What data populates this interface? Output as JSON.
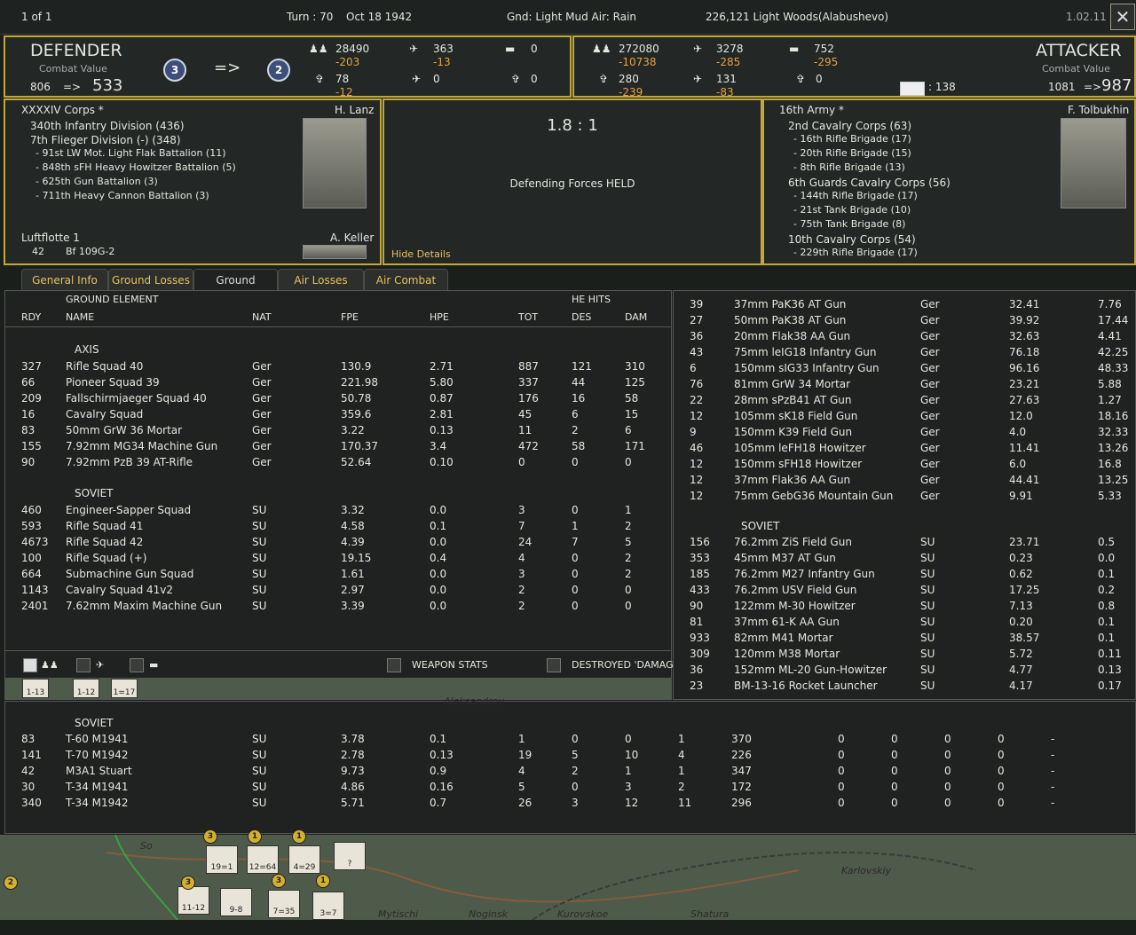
{
  "topbar": {
    "page": "1 of 1",
    "turn": "Turn : 70",
    "date": "Oct 18 1942",
    "weather": "Gnd: Light Mud  Air: Rain",
    "location": "226,121  Light Woods(Alabushevo)",
    "version": "1.02.11",
    "close": "✕"
  },
  "defender": {
    "title": "DEFENDER",
    "cv_label": "Combat Value",
    "cv_from": "806",
    "arrow": "=>",
    "cv_to": "533",
    "badge_from": "3",
    "badge_to": "2",
    "arrow_big": "=>",
    "men": "28490",
    "men_loss": "-203",
    "air": "363",
    "air_loss": "-13",
    "tanks": "0",
    "guns": "78",
    "guns_loss": "-12",
    "air2": "0",
    "guns2": "0"
  },
  "attacker": {
    "title": "ATTACKER",
    "cv_label": "Combat Value",
    "cv_from": "1081",
    "arrow": "=>",
    "cv_to": "987",
    "men": "272080",
    "men_loss": "-10738",
    "air": "3278",
    "air_loss": "-285",
    "tanks": "752",
    "tanks_loss": "-295",
    "guns": "280",
    "guns_loss": "-239",
    "air2": "131",
    "air2_loss": "-83",
    "guns2": "0",
    "trucks": ": 138"
  },
  "def_units": {
    "hq": "XXXXIV Corps *",
    "commander": "H. Lanz",
    "list": [
      {
        "t": "340th Infantry Division (436)",
        "lvl": 1
      },
      {
        "t": "7th Flieger Division (-) (348)",
        "lvl": 1
      },
      {
        "t": "- 91st LW Mot. Light Flak Battalion (11)",
        "lvl": 2
      },
      {
        "t": "- 848th sFH Heavy Howitzer Battalion (5)",
        "lvl": 2
      },
      {
        "t": "- 625th Gun Battalion (3)",
        "lvl": 2
      },
      {
        "t": "- 711th Heavy Cannon Battalion (3)",
        "lvl": 2
      }
    ],
    "air_hq": "Luftflotte 1",
    "air_commander": "A. Keller",
    "air_count": "42",
    "air_type": "Bf 109G-2"
  },
  "result": {
    "ratio": "1.8 : 1",
    "outcome": "Defending Forces HELD",
    "hide": "Hide Details"
  },
  "att_units": {
    "hq": "16th Army *",
    "commander": "F. Tolbukhin",
    "list": [
      {
        "t": "2nd Cavalry Corps (63)",
        "lvl": 1
      },
      {
        "t": "- 16th Rifle Brigade (17)",
        "lvl": 2
      },
      {
        "t": "- 20th Rifle Brigade (15)",
        "lvl": 2
      },
      {
        "t": "- 8th Rifle Brigade (13)",
        "lvl": 2
      },
      {
        "t": "6th Guards Cavalry Corps (56)",
        "lvl": 1
      },
      {
        "t": "- 144th Rifle Brigade (17)",
        "lvl": 2
      },
      {
        "t": "- 21st Tank Brigade (10)",
        "lvl": 2
      },
      {
        "t": "- 75th Tank Brigade (8)",
        "lvl": 2
      },
      {
        "t": "10th Cavalry Corps (54)",
        "lvl": 1
      },
      {
        "t": "- 229th Rifle Brigade (17)",
        "lvl": 2
      }
    ]
  },
  "tabs": [
    "General Info",
    "Ground Losses",
    "Ground Combat",
    "Air Losses",
    "Air Combat"
  ],
  "table": {
    "group_header": "GROUND ELEMENT",
    "he_hits": "HE HITS",
    "cols": [
      "RDY",
      "NAME",
      "NAT",
      "FPE",
      "HPE",
      "TOT",
      "DES",
      "DAM"
    ],
    "axis_label": "AXIS",
    "soviet_label": "SOVIET",
    "axis": [
      [
        "327",
        "Rifle Squad 40",
        "Ger",
        "130.9",
        "2.71",
        "887",
        "121",
        "310"
      ],
      [
        "66",
        "Pioneer Squad 39",
        "Ger",
        "221.98",
        "5.80",
        "337",
        "44",
        "125"
      ],
      [
        "209",
        "Fallschirmjaeger Squad 40",
        "Ger",
        "50.78",
        "0.87",
        "176",
        "16",
        "58"
      ],
      [
        "16",
        "Cavalry Squad",
        "Ger",
        "359.6",
        "2.81",
        "45",
        "6",
        "15"
      ],
      [
        "83",
        "50mm GrW 36 Mortar",
        "Ger",
        "3.22",
        "0.13",
        "11",
        "2",
        "6"
      ],
      [
        "155",
        "7.92mm MG34 Machine Gun",
        "Ger",
        "170.37",
        "3.4",
        "472",
        "58",
        "171"
      ],
      [
        "90",
        "7.92mm PzB 39 AT-Rifle",
        "Ger",
        "52.64",
        "0.10",
        "0",
        "0",
        "0"
      ]
    ],
    "soviet": [
      [
        "460",
        "Engineer-Sapper Squad",
        "SU",
        "3.32",
        "0.0",
        "3",
        "0",
        "1"
      ],
      [
        "593",
        "Rifle Squad 41",
        "SU",
        "4.58",
        "0.1",
        "7",
        "1",
        "2"
      ],
      [
        "4673",
        "Rifle Squad 42",
        "SU",
        "4.39",
        "0.0",
        "24",
        "7",
        "5"
      ],
      [
        "100",
        "Rifle Squad (+)",
        "SU",
        "19.15",
        "0.4",
        "4",
        "0",
        "2"
      ],
      [
        "664",
        "Submachine Gun Squad",
        "SU",
        "1.61",
        "0.0",
        "3",
        "0",
        "2"
      ],
      [
        "1143",
        "Cavalry Squad 41v2",
        "SU",
        "2.97",
        "0.0",
        "2",
        "0",
        "0"
      ],
      [
        "2401",
        "7.62mm Maxim Machine Gun",
        "SU",
        "3.39",
        "0.0",
        "2",
        "0",
        "0"
      ]
    ]
  },
  "filters": {
    "weapon_stats": "WEAPON STATS",
    "destroyed": "DESTROYED 'DAMAG"
  },
  "right_table": {
    "ger": [
      [
        "39",
        "37mm PaK36 AT Gun",
        "Ger",
        "32.41",
        "7.76"
      ],
      [
        "27",
        "50mm PaK38 AT Gun",
        "Ger",
        "39.92",
        "17.44"
      ],
      [
        "36",
        "20mm Flak38 AA Gun",
        "Ger",
        "32.63",
        "4.41"
      ],
      [
        "43",
        "75mm leIG18 Infantry Gun",
        "Ger",
        "76.18",
        "42.25"
      ],
      [
        "6",
        "150mm sIG33 Infantry Gun",
        "Ger",
        "96.16",
        "48.33"
      ],
      [
        "76",
        "81mm GrW 34 Mortar",
        "Ger",
        "23.21",
        "5.88"
      ],
      [
        "22",
        "28mm sPzB41 AT Gun",
        "Ger",
        "27.63",
        "1.27"
      ],
      [
        "12",
        "105mm sK18 Field Gun",
        "Ger",
        "12.0",
        "18.16"
      ],
      [
        "9",
        "150mm K39 Field Gun",
        "Ger",
        "4.0",
        "32.33"
      ],
      [
        "46",
        "105mm leFH18 Howitzer",
        "Ger",
        "11.41",
        "13.26"
      ],
      [
        "12",
        "150mm sFH18 Howitzer",
        "Ger",
        "6.0",
        "16.8"
      ],
      [
        "12",
        "37mm Flak36 AA Gun",
        "Ger",
        "44.41",
        "13.25"
      ],
      [
        "12",
        "75mm GebG36 Mountain Gun",
        "Ger",
        "9.91",
        "5.33"
      ]
    ],
    "soviet_label": "SOVIET",
    "su": [
      [
        "156",
        "76.2mm ZiS Field Gun",
        "SU",
        "23.71",
        "0.5"
      ],
      [
        "353",
        "45mm M37 AT Gun",
        "SU",
        "0.23",
        "0.0"
      ],
      [
        "185",
        "76.2mm M27 Infantry Gun",
        "SU",
        "0.62",
        "0.1"
      ],
      [
        "433",
        "76.2mm USV Field Gun",
        "SU",
        "17.25",
        "0.2"
      ],
      [
        "90",
        "122mm M-30 Howitzer",
        "SU",
        "7.13",
        "0.8"
      ],
      [
        "81",
        "37mm 61-K AA Gun",
        "SU",
        "0.20",
        "0.1"
      ],
      [
        "933",
        "82mm M41 Mortar",
        "SU",
        "38.57",
        "0.1"
      ],
      [
        "309",
        "120mm M38 Mortar",
        "SU",
        "5.72",
        "0.11"
      ],
      [
        "36",
        "152mm ML-20 Gun-Howitzer",
        "SU",
        "4.77",
        "0.13"
      ],
      [
        "23",
        "BM-13-16 Rocket Launcher",
        "SU",
        "4.17",
        "0.17"
      ]
    ]
  },
  "afv_table": {
    "soviet_label": "SOVIET",
    "rows": [
      [
        "83",
        "T-60 M1941",
        "SU",
        "3.78",
        "0.1",
        "1",
        "0",
        "0",
        "1",
        "370",
        "0",
        "0",
        "0",
        "0",
        "-"
      ],
      [
        "141",
        "T-70 M1942",
        "SU",
        "2.78",
        "0.13",
        "19",
        "5",
        "10",
        "4",
        "226",
        "0",
        "0",
        "0",
        "0",
        "-"
      ],
      [
        "42",
        "M3A1 Stuart",
        "SU",
        "9.73",
        "0.9",
        "4",
        "2",
        "1",
        "1",
        "347",
        "0",
        "0",
        "0",
        "0",
        "-"
      ],
      [
        "30",
        "T-34 M1941",
        "SU",
        "4.86",
        "0.16",
        "5",
        "0",
        "3",
        "2",
        "172",
        "0",
        "0",
        "0",
        "0",
        "-"
      ],
      [
        "340",
        "T-34 M1942",
        "SU",
        "5.71",
        "0.7",
        "26",
        "3",
        "12",
        "11",
        "296",
        "0",
        "0",
        "0",
        "0",
        "-"
      ]
    ]
  },
  "map": {
    "labels": [
      "Aleksandrov",
      "Karlovskiy",
      "Mytischi",
      "Noginsk",
      "Kurovskoe",
      "Shatura",
      "So"
    ],
    "units": [
      "1-13",
      "1-12",
      "1=17",
      "19=1",
      "12=64",
      "4=29",
      "11-12",
      "9-8",
      "7=35",
      "3=7",
      "?"
    ],
    "badges": [
      "3",
      "1",
      "1",
      "3",
      "1",
      "2",
      "3"
    ]
  }
}
